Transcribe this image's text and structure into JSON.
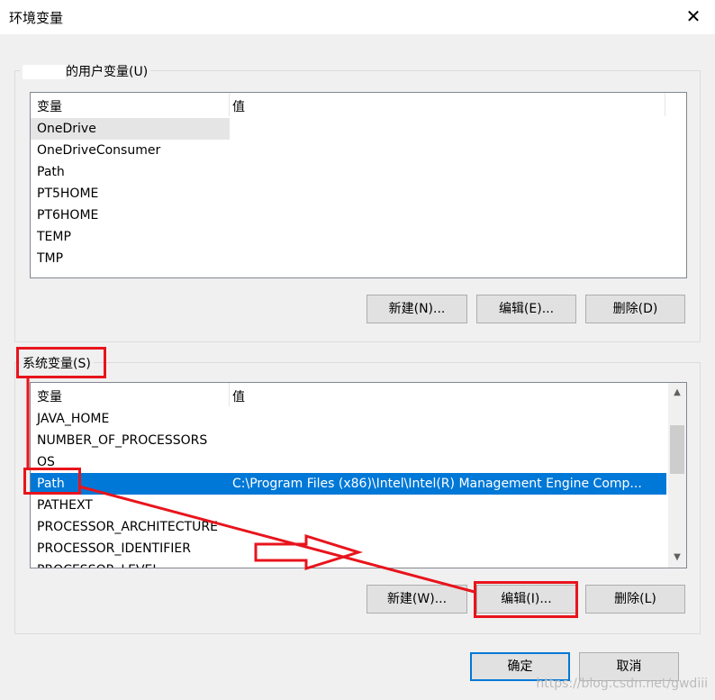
{
  "window": {
    "title": "环境变量",
    "close_icon": "close-icon"
  },
  "user_vars": {
    "legend": "的用户变量(U)",
    "col_name": "变量",
    "col_value": "值",
    "rows": [
      {
        "name": "OneDrive",
        "value": ""
      },
      {
        "name": "OneDriveConsumer",
        "value": ""
      },
      {
        "name": "Path",
        "value": ""
      },
      {
        "name": "PT5HOME",
        "value": ""
      },
      {
        "name": "PT6HOME",
        "value": ""
      },
      {
        "name": "TEMP",
        "value": ""
      },
      {
        "name": "TMP",
        "value": ""
      }
    ],
    "buttons": {
      "new": "新建(N)...",
      "edit": "编辑(E)...",
      "delete": "删除(D)"
    }
  },
  "system_vars": {
    "legend": "系统变量(S)",
    "col_name": "变量",
    "col_value": "值",
    "rows": [
      {
        "name": "JAVA_HOME",
        "value": ""
      },
      {
        "name": "NUMBER_OF_PROCESSORS",
        "value": ""
      },
      {
        "name": "OS",
        "value": ""
      },
      {
        "name": "Path",
        "value": "C:\\Program Files (x86)\\Intel\\Intel(R) Management Engine Comp..."
      },
      {
        "name": "PATHEXT",
        "value": ""
      },
      {
        "name": "PROCESSOR_ARCHITECTURE",
        "value": ""
      },
      {
        "name": "PROCESSOR_IDENTIFIER",
        "value": ""
      },
      {
        "name": "PROCESSOR_LEVEL",
        "value": ""
      }
    ],
    "buttons": {
      "new": "新建(W)...",
      "edit": "编辑(I)...",
      "delete": "删除(L)"
    }
  },
  "footer": {
    "ok": "确定",
    "cancel": "取消"
  },
  "watermark": "https://blog.csdn.net/gwdiii",
  "colors": {
    "selection": "#0078d7",
    "annotation": "#e8141c",
    "focus_border": "#0078d7"
  }
}
